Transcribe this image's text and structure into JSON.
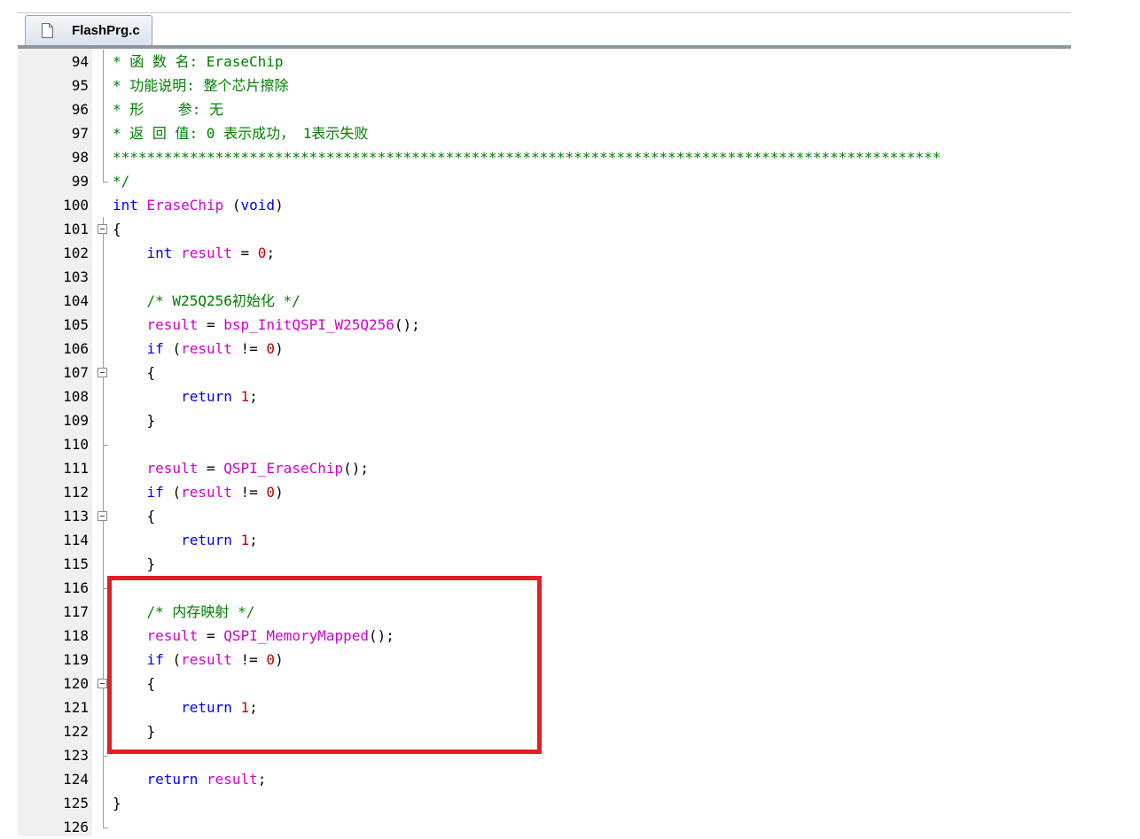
{
  "editor": {
    "tab_label": "FlashPrg.c",
    "lines": [
      {
        "num": "94",
        "code": "* 函 数 名: EraseChip"
      },
      {
        "num": "95",
        "code": "* 功能说明: 整个芯片擦除"
      },
      {
        "num": "96",
        "code": "* 形    参: 无"
      },
      {
        "num": "97",
        "code": "* 返 回 值: 0 表示成功， 1表示失败"
      },
      {
        "num": "98",
        "code": "*************************************************************************************************"
      },
      {
        "num": "99",
        "code": "*/"
      },
      {
        "num": "100",
        "code": "int EraseChip (void)"
      },
      {
        "num": "101",
        "code": "{"
      },
      {
        "num": "102",
        "code": "    int result = 0;"
      },
      {
        "num": "103",
        "code": ""
      },
      {
        "num": "104",
        "code": "    /* W25Q256初始化 */"
      },
      {
        "num": "105",
        "code": "    result = bsp_InitQSPI_W25Q256();"
      },
      {
        "num": "106",
        "code": "    if (result != 0)"
      },
      {
        "num": "107",
        "code": "    {"
      },
      {
        "num": "108",
        "code": "        return 1;"
      },
      {
        "num": "109",
        "code": "    }"
      },
      {
        "num": "110",
        "code": ""
      },
      {
        "num": "111",
        "code": "    result = QSPI_EraseChip();"
      },
      {
        "num": "112",
        "code": "    if (result != 0)"
      },
      {
        "num": "113",
        "code": "    {"
      },
      {
        "num": "114",
        "code": "        return 1;"
      },
      {
        "num": "115",
        "code": "    }"
      },
      {
        "num": "116",
        "code": ""
      },
      {
        "num": "117",
        "code": "    /* 内存映射 */"
      },
      {
        "num": "118",
        "code": "    result = QSPI_MemoryMapped();"
      },
      {
        "num": "119",
        "code": "    if (result != 0)"
      },
      {
        "num": "120",
        "code": "    {"
      },
      {
        "num": "121",
        "code": "        return 1;"
      },
      {
        "num": "122",
        "code": "    }"
      },
      {
        "num": "123",
        "code": ""
      },
      {
        "num": "124",
        "code": "    return result;"
      },
      {
        "num": "125",
        "code": "}"
      },
      {
        "num": "126",
        "code": ""
      }
    ]
  },
  "colors": {
    "comment": "#008000",
    "keyword": "#0000ff",
    "function": "#d000d0",
    "number": "#c00000",
    "highlight_border": "#e01e26"
  }
}
